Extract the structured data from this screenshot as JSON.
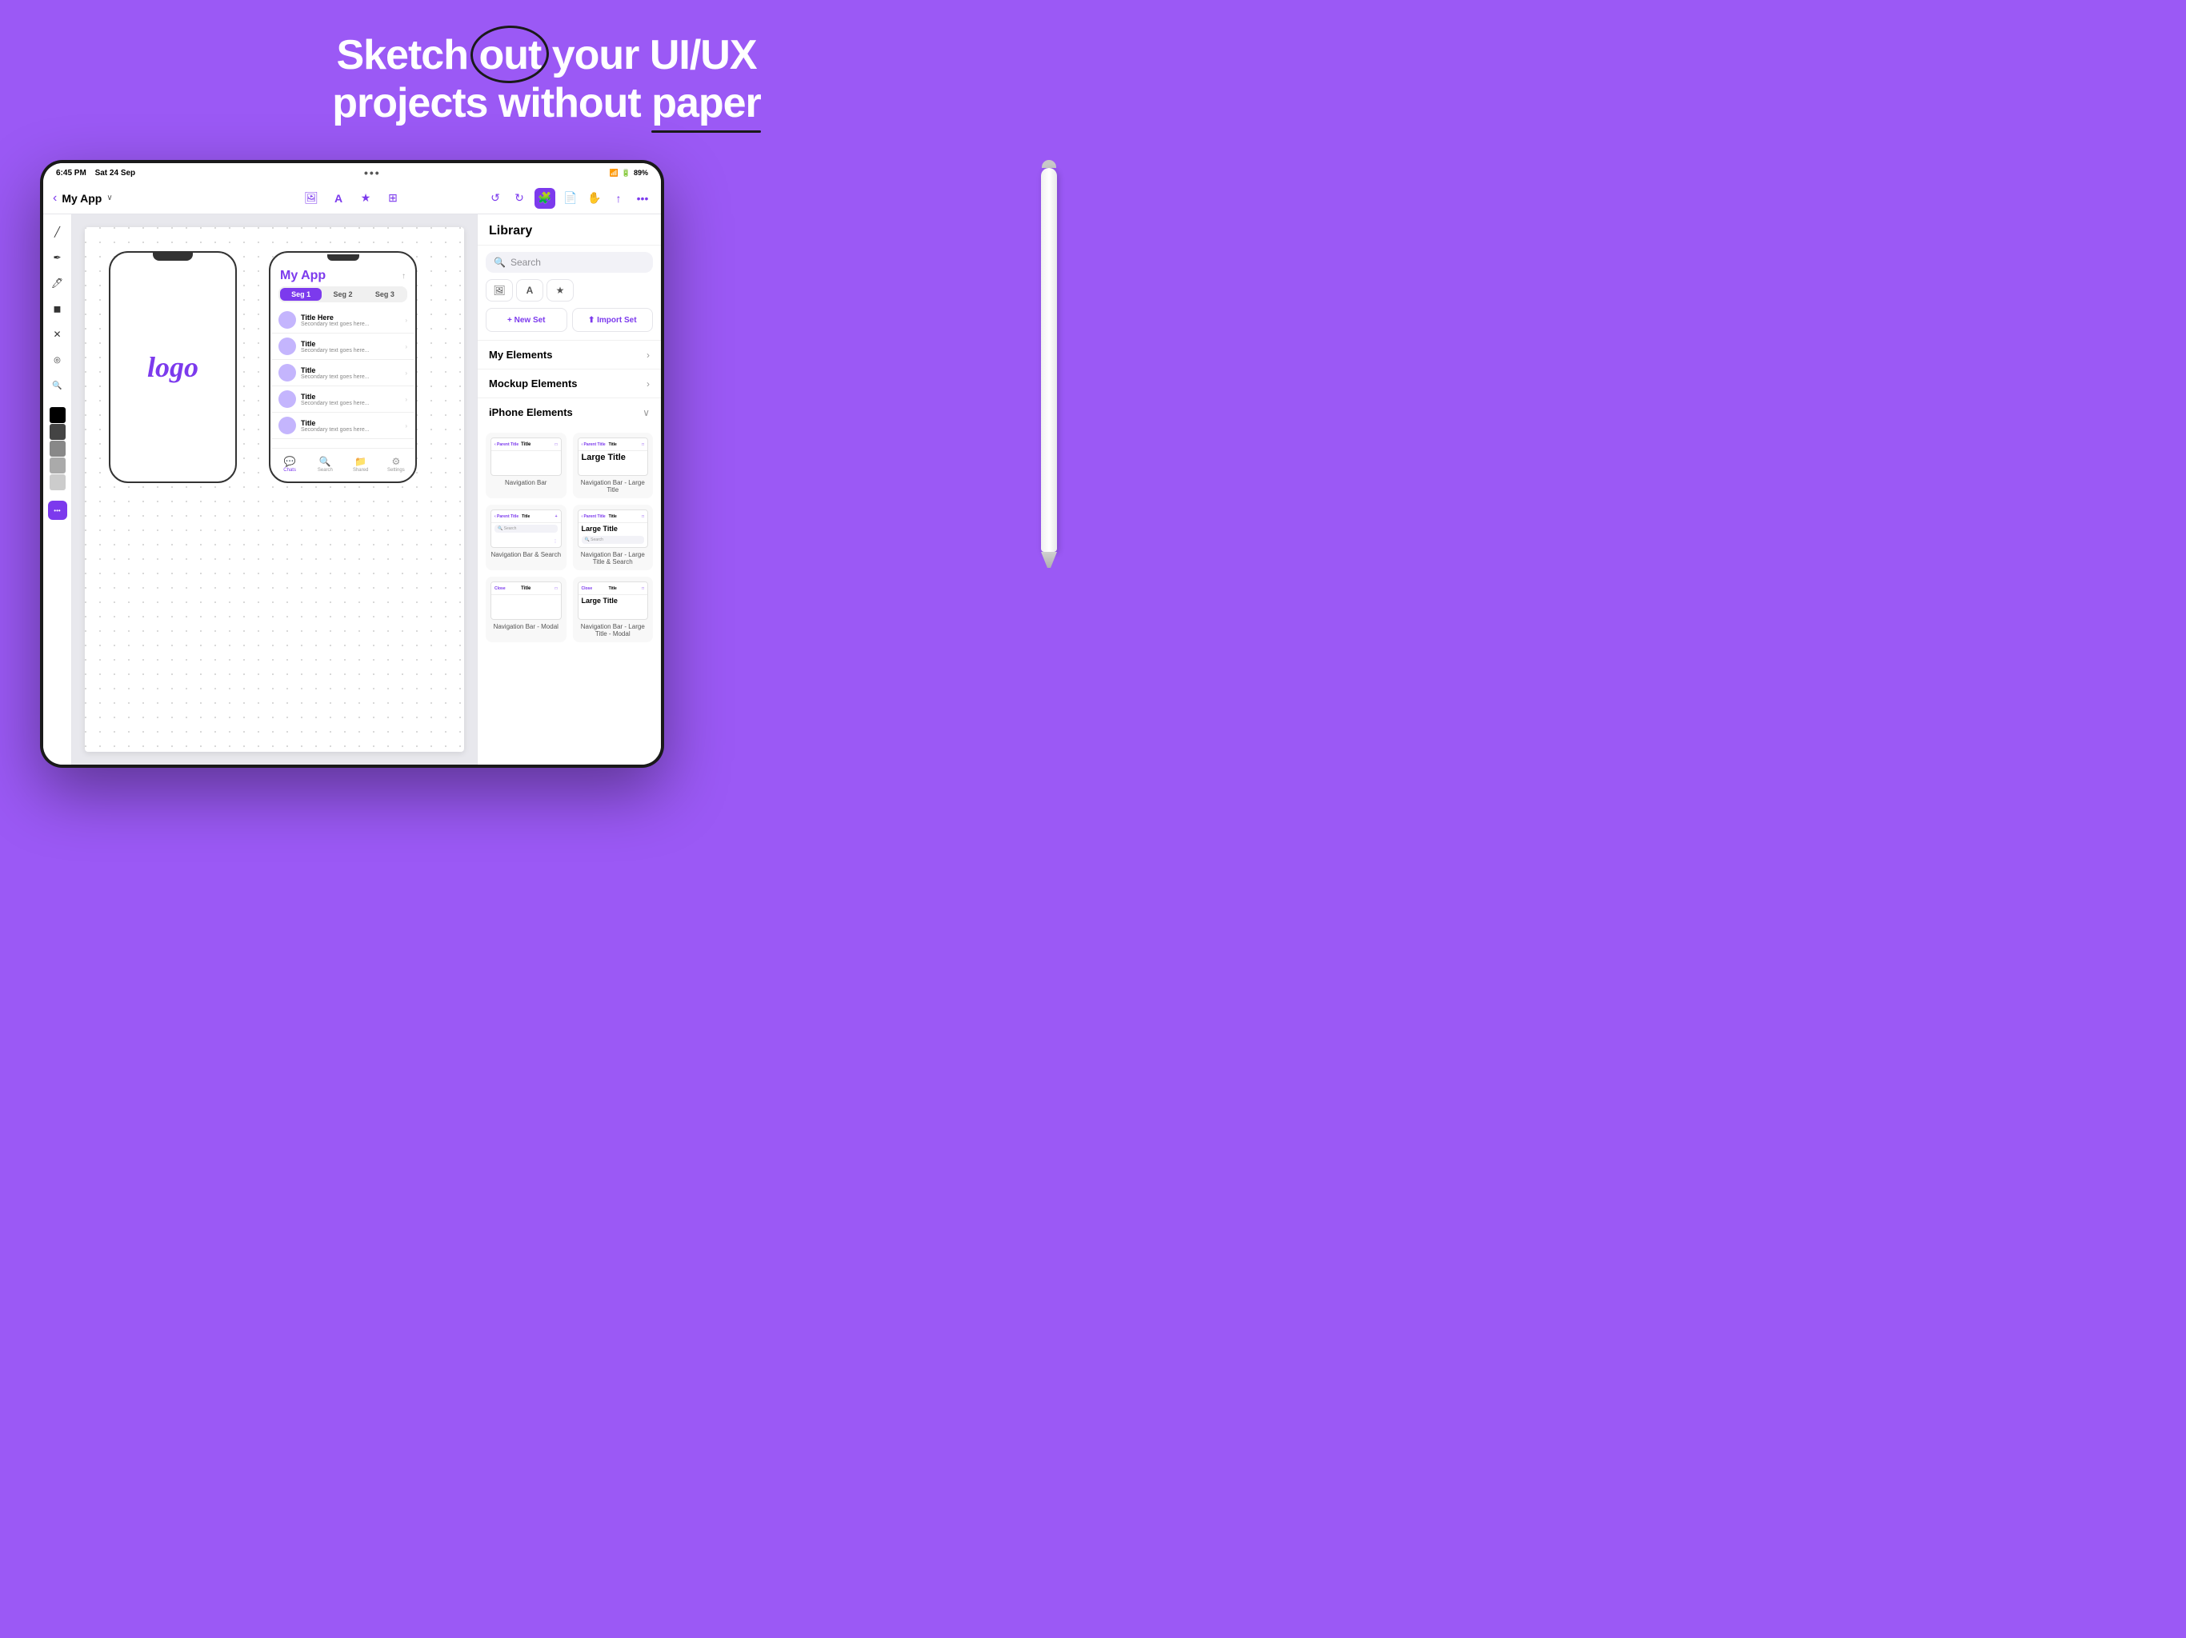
{
  "hero": {
    "line1_pre": "Sketch ",
    "line1_highlight": "out",
    "line1_post": " your UI/UX",
    "line2_pre": "projects without ",
    "line2_underline": "paper"
  },
  "status_bar": {
    "time": "6:45 PM",
    "date": "Sat 24 Sep",
    "battery": "89%",
    "wifi": "WiFi",
    "signal": "●●●"
  },
  "toolbar": {
    "back_label": "‹",
    "app_name": "My App",
    "dropdown": "∨",
    "dots": "•••",
    "icons": [
      "🖼",
      "A",
      "★",
      "⊞"
    ],
    "right_icons": [
      "↺",
      "↻",
      "🧩",
      "📄",
      "✋",
      "↑",
      "•••"
    ]
  },
  "library": {
    "title": "Library",
    "search_placeholder": "Search",
    "filter_icons": [
      "🖼",
      "A",
      "★"
    ],
    "new_set_label": "+ New Set",
    "import_set_label": "⬆ Import Set",
    "sections": [
      {
        "label": "My Elements",
        "expanded": false,
        "chevron": "›"
      },
      {
        "label": "Mockup Elements",
        "expanded": false,
        "chevron": "›"
      },
      {
        "label": "iPhone Elements",
        "expanded": true,
        "chevron": "∨"
      }
    ],
    "iphone_elements": [
      {
        "label": "Navigation Bar",
        "type": "nav"
      },
      {
        "label": "Navigation Bar - Large Title",
        "type": "nav-large"
      },
      {
        "label": "Navigation Bar & Search",
        "type": "nav-search"
      },
      {
        "label": "Navigation Bar - Large Title & Search",
        "type": "nav-large-search"
      },
      {
        "label": "Navigation Bar - Modal",
        "type": "nav-modal"
      },
      {
        "label": "Navigation Bar - Large Title - Modal",
        "type": "nav-large-modal"
      }
    ]
  },
  "phone1": {
    "logo_text": "logo"
  },
  "phone2": {
    "app_title": "My App",
    "segments": [
      "Seg 1",
      "Seg 2",
      "Seg 3"
    ],
    "list_items": [
      {
        "title": "Title Here",
        "subtitle": "Secondary text goes here..."
      },
      {
        "title": "Title",
        "subtitle": "Secondary text goes here..."
      },
      {
        "title": "Title",
        "subtitle": "Secondary text goes here..."
      },
      {
        "title": "Title",
        "subtitle": "Secondary text goes here..."
      },
      {
        "title": "Title",
        "subtitle": "Secondary text goes here..."
      }
    ],
    "tab_items": [
      {
        "icon": "💬",
        "label": "Chats",
        "active": true
      },
      {
        "icon": "🔍",
        "label": "Search",
        "active": false
      },
      {
        "icon": "📁",
        "label": "Shared",
        "active": false
      },
      {
        "icon": "⚙",
        "label": "Settings",
        "active": false
      }
    ]
  },
  "drawing_tools": [
    "✏",
    "✒",
    "🖊",
    "◼",
    "✕",
    "⚑",
    "🔍"
  ],
  "colors": {
    "background": "#9b59f5",
    "purple": "#7c3aed",
    "accent": "#7c3aed"
  }
}
